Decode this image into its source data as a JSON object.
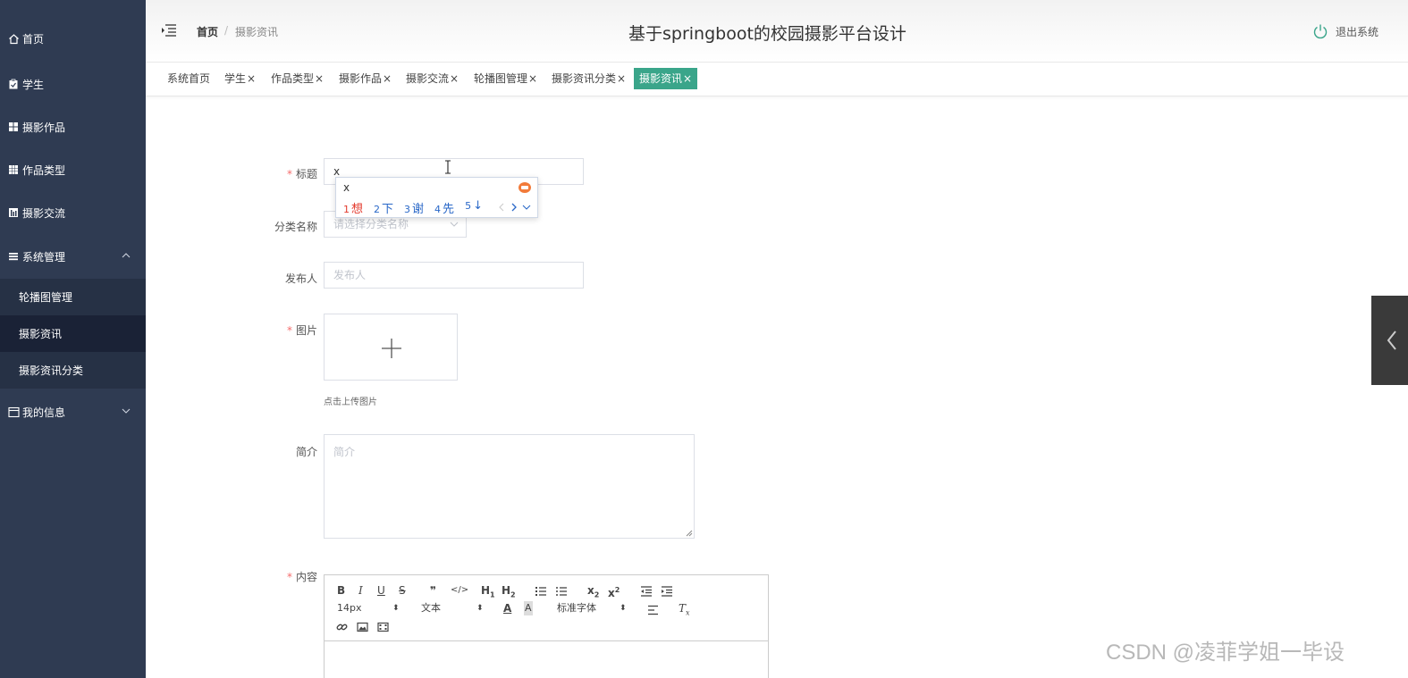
{
  "sidebar": {
    "items": [
      {
        "label": "首页",
        "icon": "home-icon"
      },
      {
        "label": "学生",
        "icon": "clipboard-icon"
      },
      {
        "label": "摄影作品",
        "icon": "grid-icon"
      },
      {
        "label": "作品类型",
        "icon": "table-icon"
      },
      {
        "label": "摄影交流",
        "icon": "chart-icon"
      },
      {
        "label": "系统管理",
        "icon": "list-icon"
      },
      {
        "label": "我的信息",
        "icon": "window-icon"
      }
    ],
    "submenu": [
      {
        "label": "轮播图管理"
      },
      {
        "label": "摄影资讯"
      },
      {
        "label": "摄影资讯分类"
      }
    ]
  },
  "header": {
    "breadcrumb_home": "首页",
    "breadcrumb_sep": "/",
    "breadcrumb_current": "摄影资讯",
    "title": "基于springboot的校园摄影平台设计",
    "logout": "退出系统"
  },
  "tabs": [
    {
      "label": "系统首页",
      "closable": ""
    },
    {
      "label": "学生",
      "closable": "×"
    },
    {
      "label": "作品类型",
      "closable": "×"
    },
    {
      "label": "摄影作品",
      "closable": "×"
    },
    {
      "label": "摄影交流",
      "closable": "×"
    },
    {
      "label": "轮播图管理",
      "closable": "×"
    },
    {
      "label": "摄影资讯分类",
      "closable": "×"
    },
    {
      "label": "摄影资讯",
      "closable": "×"
    }
  ],
  "form": {
    "required_mark": "*",
    "title_label": "标题",
    "title_value": "x",
    "category_label": "分类名称",
    "category_placeholder": "请选择分类名称",
    "publisher_label": "发布人",
    "publisher_placeholder": "发布人",
    "image_label": "图片",
    "upload_tip": "点击上传图片",
    "intro_label": "简介",
    "intro_placeholder": "简介",
    "content_label": "内容"
  },
  "ime": {
    "composition": "x",
    "candidates": [
      {
        "num": "1",
        "text": "想"
      },
      {
        "num": "2",
        "text": "下"
      },
      {
        "num": "3",
        "text": "谢"
      },
      {
        "num": "4",
        "text": "先"
      },
      {
        "num": "5",
        "text": "↓"
      }
    ]
  },
  "editor": {
    "font_size": "14px",
    "block_type": "文本",
    "font_family": "标准字体"
  },
  "watermark": "CSDN @凌菲学姐一毕设",
  "colors": {
    "sidebar_bg": "#2f3b52",
    "active_tab": "#3aa58a",
    "required": "#f56c6c"
  }
}
